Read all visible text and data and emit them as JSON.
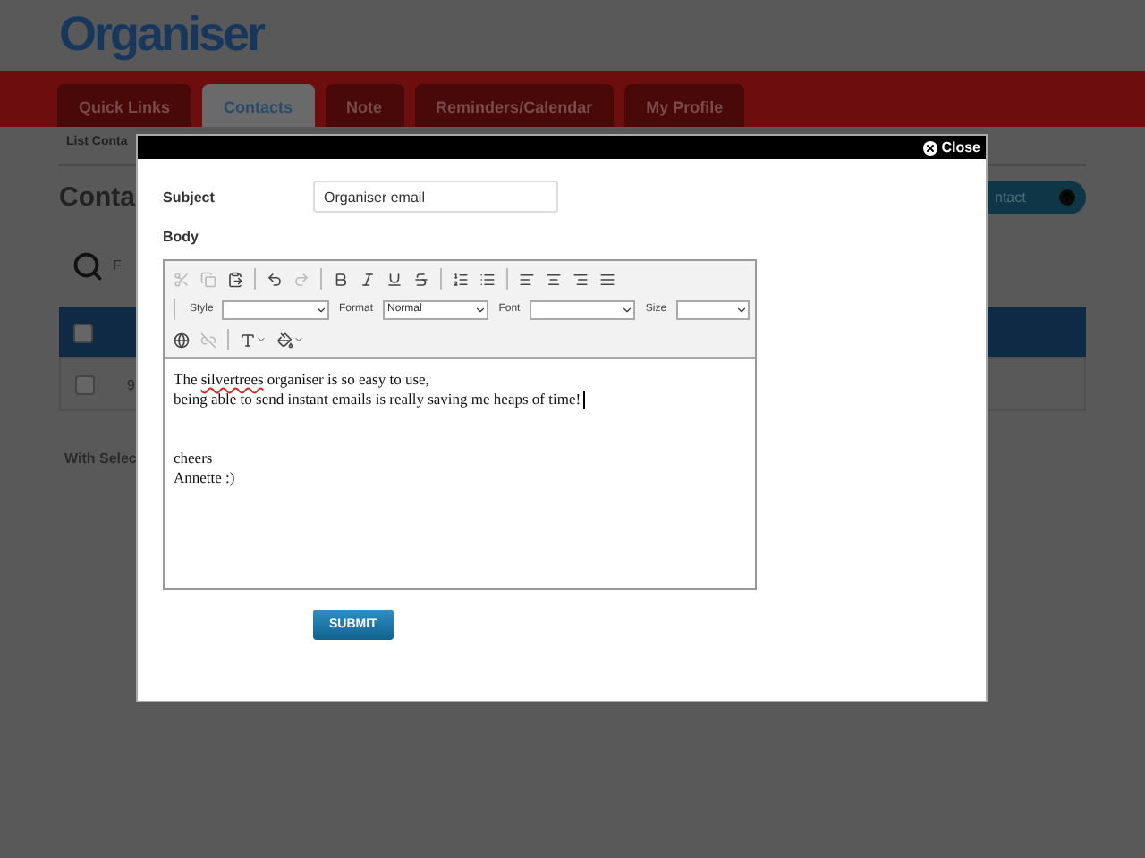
{
  "header": {
    "logo": "Organiser"
  },
  "tabs": [
    {
      "label": "Quick Links",
      "selected": false
    },
    {
      "label": "Contacts",
      "selected": true
    },
    {
      "label": "Note",
      "selected": false
    },
    {
      "label": "Reminders/Calendar",
      "selected": false
    },
    {
      "label": "My Profile",
      "selected": false
    }
  ],
  "subnav": {
    "label": "List Conta"
  },
  "page": {
    "title": "Conta",
    "add_button": "ntact",
    "search_label": "F"
  },
  "table": {
    "header_checked": false,
    "rows": [
      {
        "checked": false,
        "column_2": "9"
      }
    ]
  },
  "bulk_label": "With Selec",
  "modal": {
    "close": "Close",
    "subject": {
      "label": "Subject",
      "value": "Organiser email"
    },
    "body_label": "Body",
    "toolbar": [
      [
        {
          "kind": "cut",
          "disabled": true
        },
        {
          "kind": "copy",
          "disabled": true
        },
        {
          "kind": "paste",
          "disabled": false
        },
        {
          "kind": "sep"
        },
        {
          "kind": "undo",
          "disabled": false
        },
        {
          "kind": "redo",
          "disabled": true
        },
        {
          "kind": "sep"
        },
        {
          "kind": "bold",
          "disabled": false
        },
        {
          "kind": "italic",
          "disabled": false
        },
        {
          "kind": "underline",
          "disabled": false
        },
        {
          "kind": "strike",
          "disabled": false
        },
        {
          "kind": "sep"
        },
        {
          "kind": "olist",
          "disabled": false
        },
        {
          "kind": "ulist",
          "disabled": false
        },
        {
          "kind": "sep"
        },
        {
          "kind": "left",
          "disabled": false
        },
        {
          "kind": "center",
          "disabled": false
        },
        {
          "kind": "right",
          "disabled": false
        },
        {
          "kind": "justify",
          "disabled": false
        }
      ],
      [
        {
          "kind": "link",
          "disabled": false
        },
        {
          "kind": "unlink",
          "disabled": true
        },
        {
          "kind": "sep"
        },
        {
          "kind": "textcolor",
          "disabled": false
        },
        {
          "kind": "bgcolor",
          "disabled": false
        }
      ]
    ],
    "selects": [
      {
        "label": "Style"
      },
      {
        "label": "Format",
        "value": "Normal"
      },
      {
        "label": "Font"
      },
      {
        "label": "Size"
      }
    ],
    "content": [
      {
        "lines": [
          {
            "cursor": false,
            "segments": [
              {
                "text": "The ",
                "misspelled": false
              },
              {
                "text": "silvertrees",
                "misspelled": true
              },
              {
                "text": " organiser is so easy to use,",
                "misspelled": false
              }
            ]
          },
          {
            "cursor": true,
            "segments": [
              {
                "text": "being able to send instant emails is really saving me heaps of time!",
                "misspelled": false
              }
            ]
          }
        ]
      },
      {
        "lines": [
          {
            "cursor": false,
            "segments": [
              {
                "text": "cheers",
                "misspelled": false
              }
            ]
          },
          {
            "cursor": false,
            "segments": [
              {
                "text": "Annette :)",
                "misspelled": false
              }
            ]
          }
        ]
      }
    ],
    "submit": "SUBMIT"
  }
}
